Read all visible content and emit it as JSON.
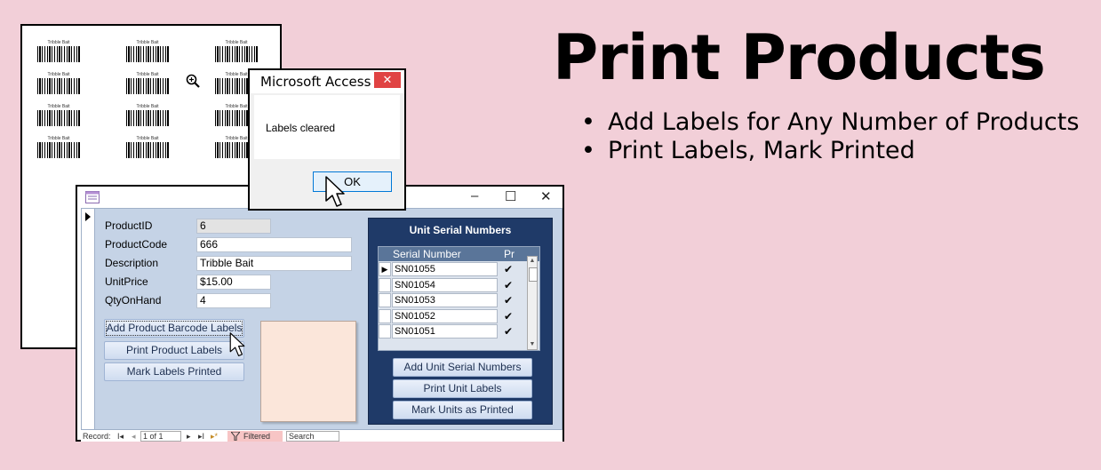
{
  "headline": "Print Products",
  "bullets": [
    {
      "dot": "•",
      "text": "Add Labels for Any Number of Products"
    },
    {
      "dot": "•",
      "text": "Print Labels, Mark Printed"
    }
  ],
  "label_sheet": {
    "label_text": "Tribble Bait",
    "zoom_icon": "magnifier-plus-icon"
  },
  "form": {
    "window_controls": {
      "minimize": "–",
      "maximize": "☐",
      "close": "✕"
    },
    "fields": {
      "product_id": {
        "label": "ProductID",
        "value": "6"
      },
      "product_code": {
        "label": "ProductCode",
        "value": "666"
      },
      "description": {
        "label": "Description",
        "value": "Tribble Bait"
      },
      "unit_price": {
        "label": "UnitPrice",
        "value": "$15.00"
      },
      "qty_on_hand": {
        "label": "QtyOnHand",
        "value": "4"
      }
    },
    "buttons": {
      "add_labels": "Add Product Barcode Labels",
      "print_labels": "Print Product Labels",
      "mark_printed": "Mark Labels Printed"
    },
    "subform": {
      "title": "Unit Serial Numbers",
      "col_serial": "Serial Number",
      "col_printed": "Pr",
      "rows": [
        {
          "serial": "SN01055",
          "printed": "✔",
          "current": "▶"
        },
        {
          "serial": "SN01054",
          "printed": "✔",
          "current": ""
        },
        {
          "serial": "SN01053",
          "printed": "✔",
          "current": ""
        },
        {
          "serial": "SN01052",
          "printed": "✔",
          "current": ""
        },
        {
          "serial": "SN01051",
          "printed": "✔",
          "current": ""
        }
      ],
      "buttons": {
        "add_serials": "Add Unit Serial Numbers",
        "print_units": "Print Unit Labels",
        "mark_units": "Mark Units as Printed"
      }
    },
    "navbar": {
      "record_label": "Record:",
      "position": "1 of 1",
      "filtered": "Filtered",
      "search": "Search",
      "first": "I◂",
      "prev": "◂",
      "next": "▸",
      "last": "▸I",
      "new": "▸*"
    }
  },
  "message_box": {
    "title": "Microsoft Access",
    "close": "✕",
    "message": "Labels cleared",
    "ok": "OK"
  },
  "colors": {
    "background": "#f2cfd8",
    "form_body": "#c5d3e6",
    "subform_panel": "#1f3a68",
    "close_button": "#e04343"
  }
}
